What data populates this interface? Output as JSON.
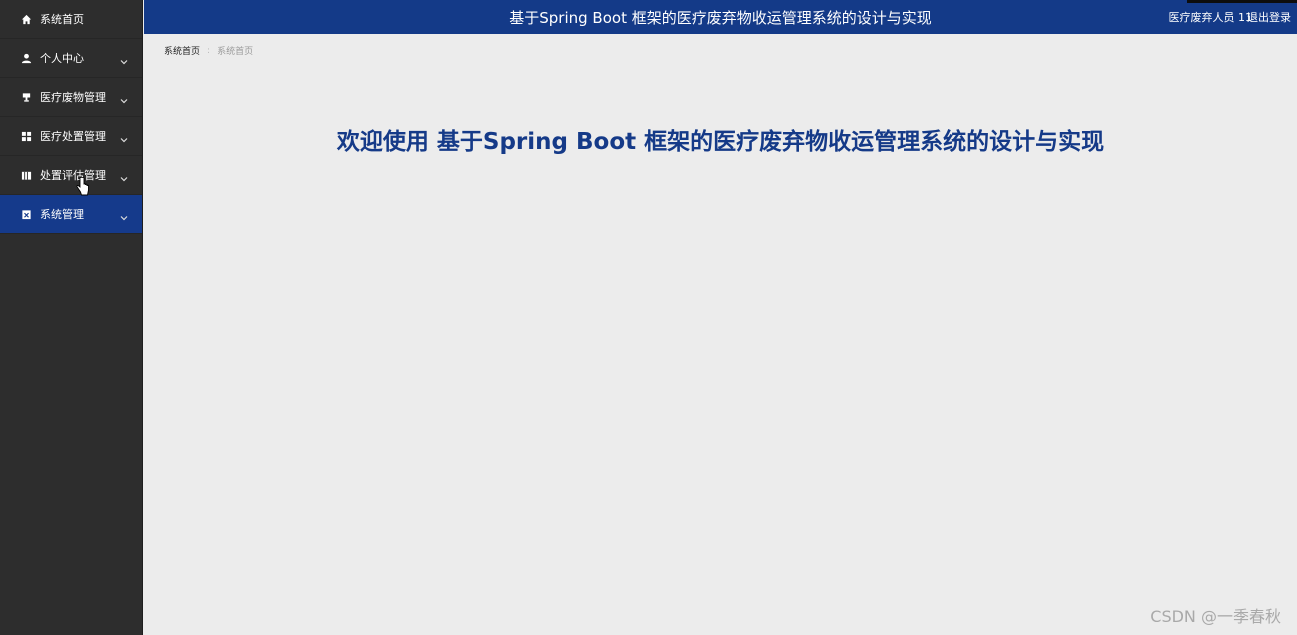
{
  "header": {
    "title": "基于Spring Boot 框架的医疗废弃物收运管理系统的设计与实现",
    "user": "医疗废弃人员 11",
    "logout": "退出登录"
  },
  "sidebar": {
    "items": [
      {
        "label": "系统首页",
        "icon": "home-icon"
      },
      {
        "label": "个人中心",
        "icon": "user-icon"
      },
      {
        "label": "医疗废物管理",
        "icon": "trophy-icon"
      },
      {
        "label": "医疗处置管理",
        "icon": "grid-icon"
      },
      {
        "label": "处置评估管理",
        "icon": "book-icon"
      },
      {
        "label": "系统管理",
        "icon": "clipboard-icon",
        "active": true
      }
    ]
  },
  "breadcrumb": {
    "home": "系统首页",
    "separator": ":",
    "current": "系统首页"
  },
  "main": {
    "welcome": "欢迎使用 基于Spring Boot 框架的医疗废弃物收运管理系统的设计与实现"
  },
  "watermark": "CSDN @一季春秋",
  "colors": {
    "brand": "#143a88",
    "sidebar_bg": "#2d2d2d",
    "active_item": "#153a8b",
    "content_bg": "#ececec"
  }
}
